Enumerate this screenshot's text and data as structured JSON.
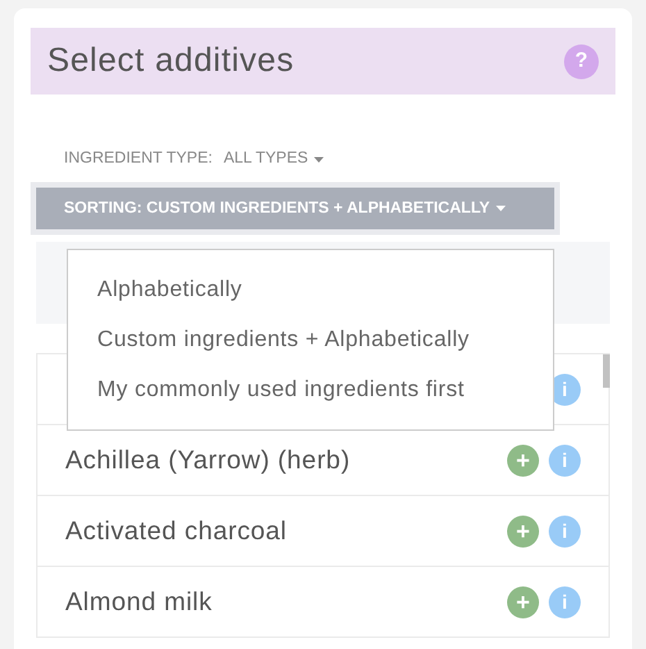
{
  "header": {
    "title": "Select additives",
    "help_icon": "?"
  },
  "filters": {
    "type_label": "INGREDIENT TYPE:",
    "type_value": "ALL TYPES",
    "sorting": "SORTING: CUSTOM INGREDIENTS + ALPHABETICALLY"
  },
  "sorting_menu": [
    "Alphabetically",
    "Custom ingredients + Alphabetically",
    "My commonly used ingredients first"
  ],
  "rows": [
    {
      "name": null,
      "info": "i"
    },
    {
      "name": "Achillea (Yarrow) (herb)",
      "add": "+",
      "info": "i"
    },
    {
      "name": "Activated charcoal",
      "add": "+",
      "info": "i"
    },
    {
      "name": "Almond milk",
      "add": "+",
      "info": "i"
    }
  ]
}
